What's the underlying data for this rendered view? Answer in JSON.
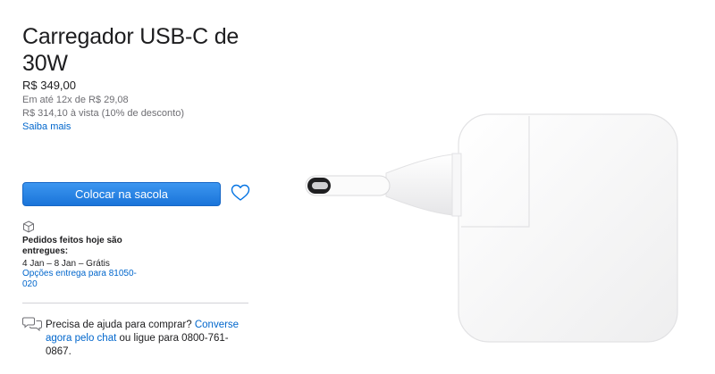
{
  "product": {
    "title": "Carregador USB-C de 30W",
    "price": "R$ 349,00",
    "installments": "Em até 12x de R$ 29,08",
    "cash_price": "R$ 314,10 à vista (10% de desconto)",
    "learn_more": "Saiba mais"
  },
  "actions": {
    "add_to_bag": "Colocar na sacola",
    "favorite_icon": "heart-icon"
  },
  "delivery": {
    "icon": "box-icon",
    "heading": "Pedidos feitos hoje são entregues:",
    "dates": "4 Jan – 8 Jan – Grátis",
    "options_link": "Opções entrega para 81050-020"
  },
  "help": {
    "icon": "chat-icon",
    "prefix": "Precisa de ajuda para comprar? ",
    "chat_link": "Converse agora pelo chat",
    "suffix": " ou ligue para 0800-761-0867."
  },
  "colors": {
    "accent": "#0071e3",
    "link": "#0066cc",
    "text": "#1d1d1f",
    "secondary_text": "#6e6e73"
  }
}
